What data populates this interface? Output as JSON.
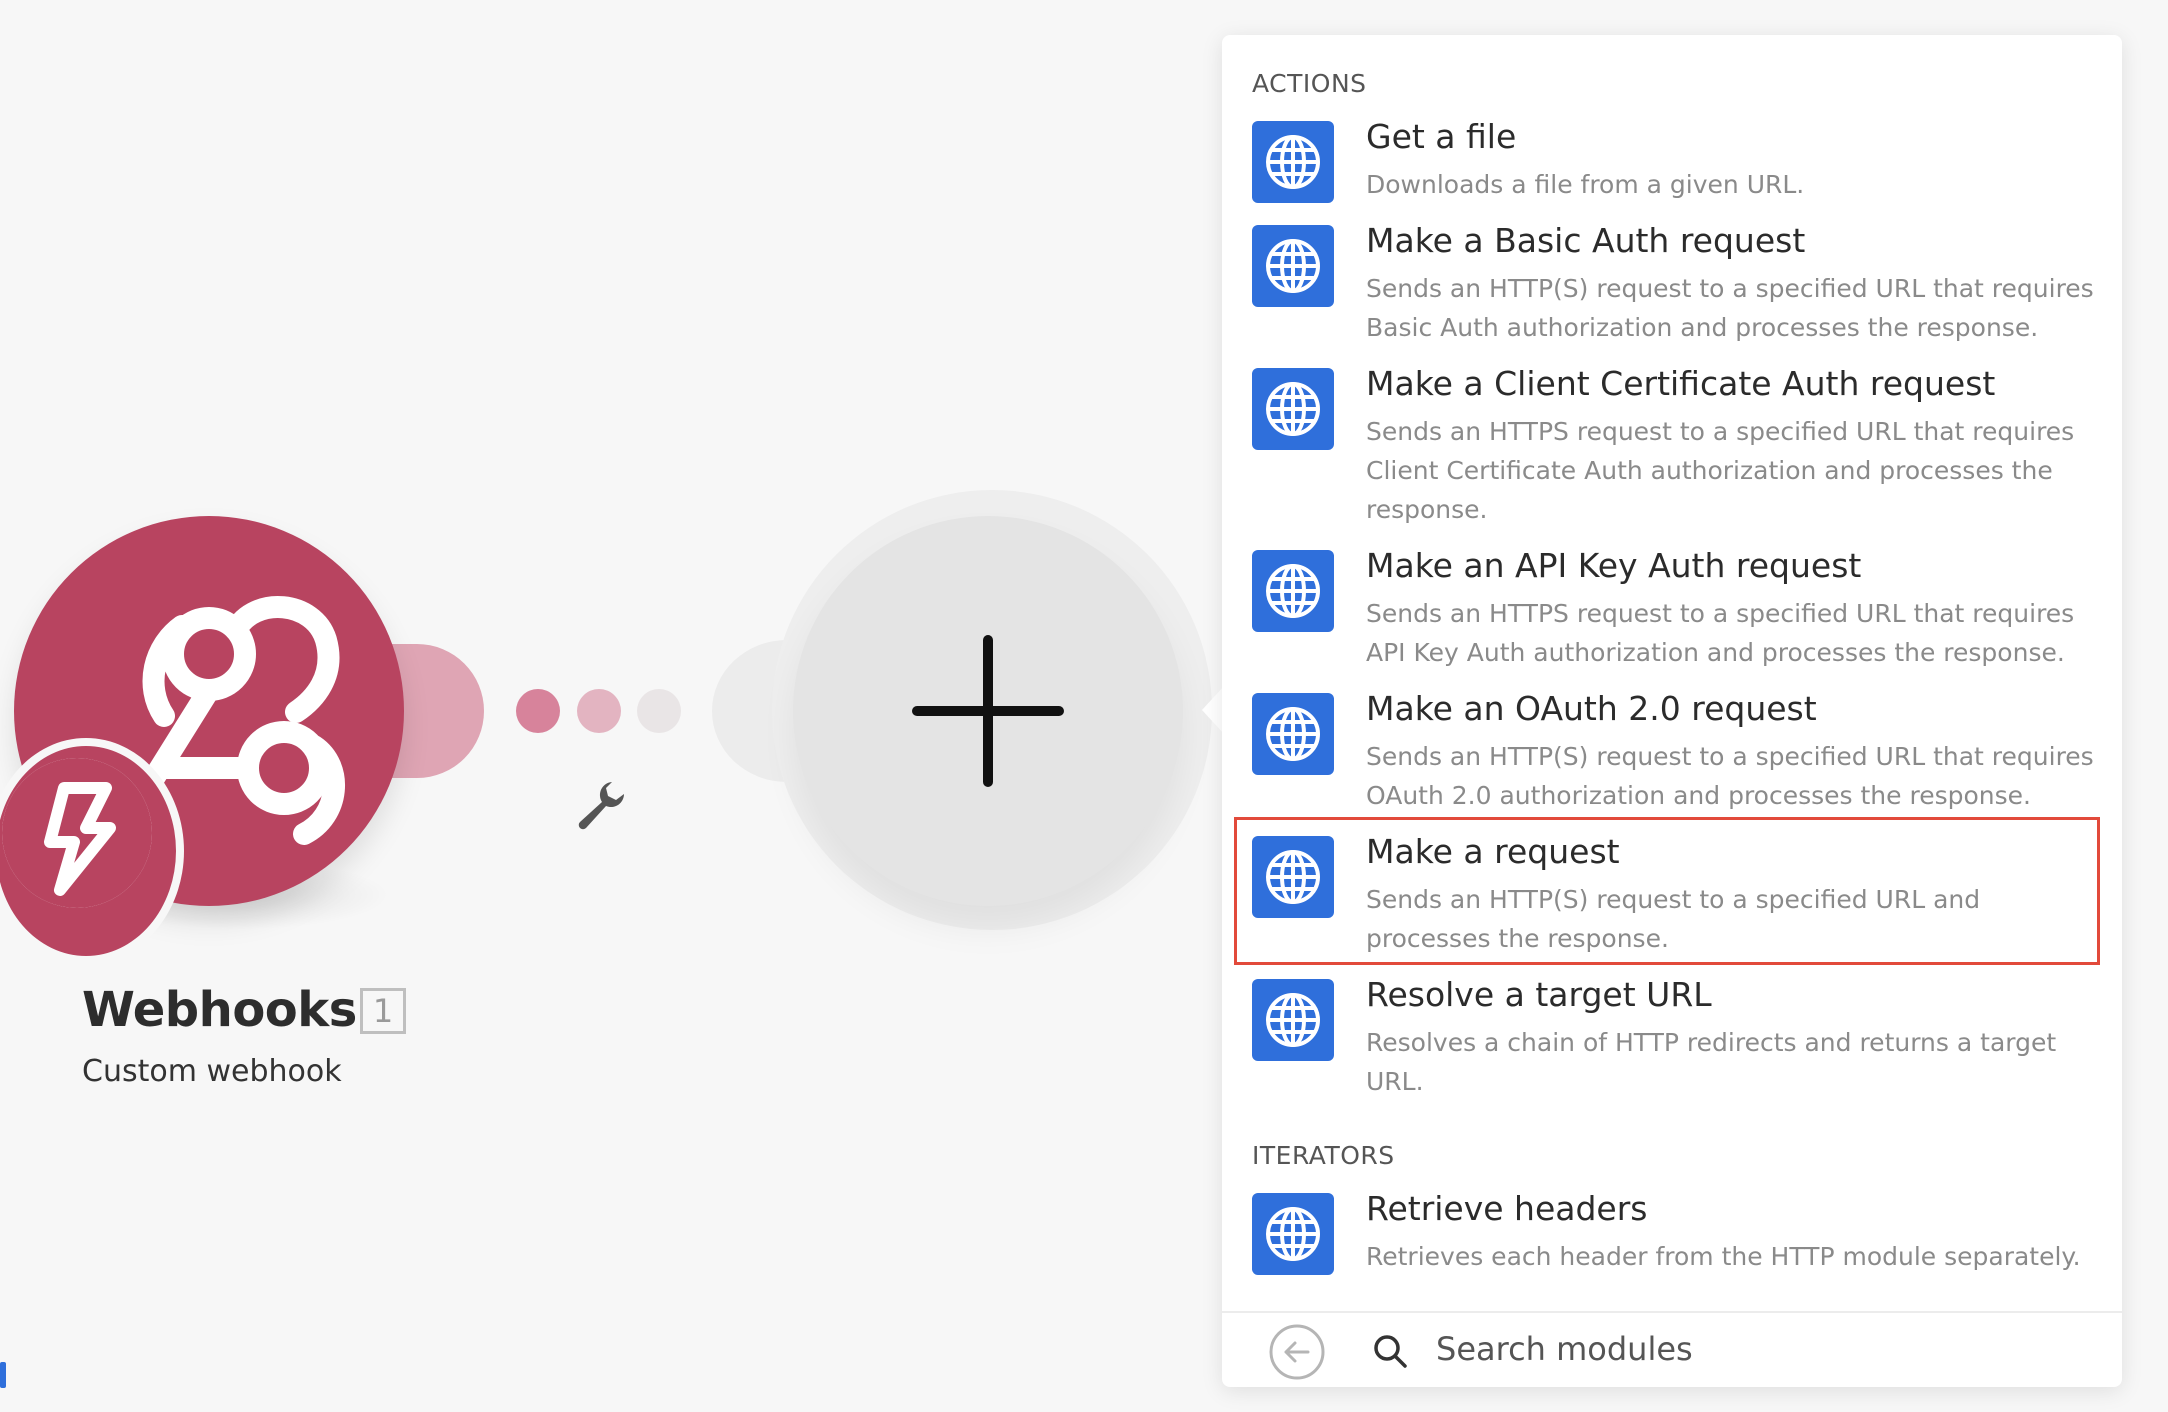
{
  "canvas": {
    "module": {
      "name": "Webhooks",
      "badge": "1",
      "subtitle": "Custom webhook",
      "icon": "webhook-icon",
      "trigger_icon": "lightning-icon",
      "color": "#b84460"
    },
    "connector_icon": "wrench-icon",
    "add_icon": "plus-icon"
  },
  "panel": {
    "sections": [
      {
        "title": "ACTIONS",
        "items": [
          {
            "title": "Get a file",
            "desc": "Downloads a file from a given URL."
          },
          {
            "title": "Make a Basic Auth request",
            "desc": "Sends an HTTP(S) request to a specified URL that requires Basic Auth authorization and processes the response."
          },
          {
            "title": "Make a Client Certificate Auth request",
            "desc": "Sends an HTTPS request to a specified URL that requires Client Certificate Auth authorization and processes the response."
          },
          {
            "title": "Make an API Key Auth request",
            "desc": "Sends an HTTPS request to a specified URL that requires API Key Auth authorization and processes the response."
          },
          {
            "title": "Make an OAuth 2.0 request",
            "desc": "Sends an HTTP(S) request to a specified URL that requires OAuth 2.0 authorization and processes the response."
          },
          {
            "title": "Make a request",
            "desc": "Sends an HTTP(S) request to a specified URL and processes the response.",
            "highlighted": true
          },
          {
            "title": "Resolve a target URL",
            "desc": "Resolves a chain of HTTP redirects and returns a target URL."
          }
        ]
      },
      {
        "title": "ITERATORS",
        "items": [
          {
            "title": "Retrieve headers",
            "desc": "Retrieves each header from the HTTP module separately."
          }
        ]
      }
    ],
    "item_icon": "globe-icon",
    "item_icon_color": "#2f6fdb",
    "highlight_color": "#e24a3b",
    "footer": {
      "back_icon": "back-arrow-icon",
      "search_icon": "search-icon",
      "search_placeholder": "Search modules"
    }
  }
}
